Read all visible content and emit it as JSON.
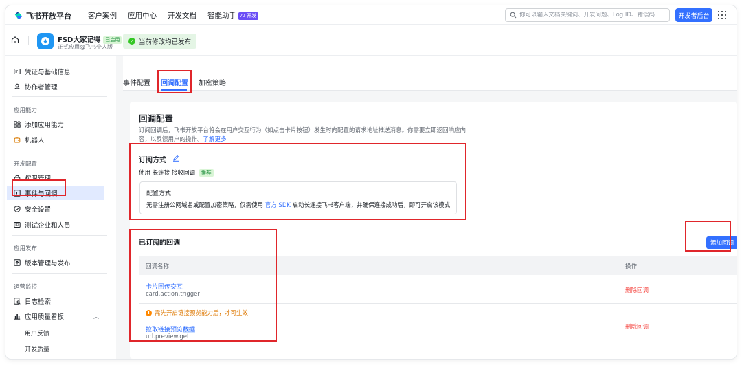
{
  "topnav": {
    "logo_text": "飞书开放平台",
    "links": [
      "客户案例",
      "应用中心",
      "开发文档",
      "智能助手"
    ],
    "ai_badge": "AI 开发",
    "search_placeholder": "你可以输入文档关键词、开发问题、Log ID、错误码",
    "dev_console": "开发者后台"
  },
  "app": {
    "name": "FSD大家记得",
    "state": "已启用",
    "subtitle": "正式应用@飞书个人版",
    "publish_status": "当前修改均已发布"
  },
  "sidebar": {
    "items_top": [
      "凭证与基础信息",
      "协作者管理"
    ],
    "group_ability": "应用能力",
    "items_ability": [
      "添加应用能力",
      "机器人"
    ],
    "group_dev": "开发配置",
    "items_dev": [
      "权限管理",
      "事件与回调",
      "安全设置",
      "测试企业和人员"
    ],
    "group_release": "应用发布",
    "items_release": [
      "版本管理与发布"
    ],
    "group_ops": "运营监控",
    "items_ops": [
      "日志检索",
      "应用质量看板"
    ],
    "sub_ops": [
      "用户反馈",
      "开发质量"
    ]
  },
  "tabs": [
    "事件配置",
    "回调配置",
    "加密策略"
  ],
  "callback": {
    "title": "回调配置",
    "desc": "订阅回调后，飞书开放平台将会在用户交互行为（如点击卡片按钮）发生时向配置的请求地址推送消息。你需要立即返回响应内容，以反馈用户的操作。",
    "learn_more": "了解更多",
    "sub_mode_title": "订阅方式",
    "sub_mode_prefix": "使用",
    "sub_mode_value": "长连接",
    "sub_mode_suffix": "接收回调",
    "recommend": "推荐",
    "config_title": "配置方式",
    "config_desc_a": "无需注册公网域名或配置加密策略，仅需使用",
    "config_desc_link": "官方 SDK",
    "config_desc_b": "启动长连接飞书客户端，并确保连接成功后，即可开启该模式",
    "subscribed_title": "已订阅的回调",
    "add_button": "添加回调",
    "col_name": "回调名称",
    "col_op": "操作",
    "rows": [
      {
        "name": "卡片回传交互",
        "key": "card.action.trigger",
        "action": "删除回调"
      },
      {
        "warning": "需先开启链接预览能力后，才可生效",
        "name_a": "拉取链接预览",
        "name_b": "数据",
        "key": "url.preview.get",
        "action": "删除回调"
      }
    ]
  },
  "colors": {
    "accent": "#3370ff",
    "danger": "#f54a45",
    "warning": "#de7802",
    "highlight_box": "#e0262b"
  }
}
